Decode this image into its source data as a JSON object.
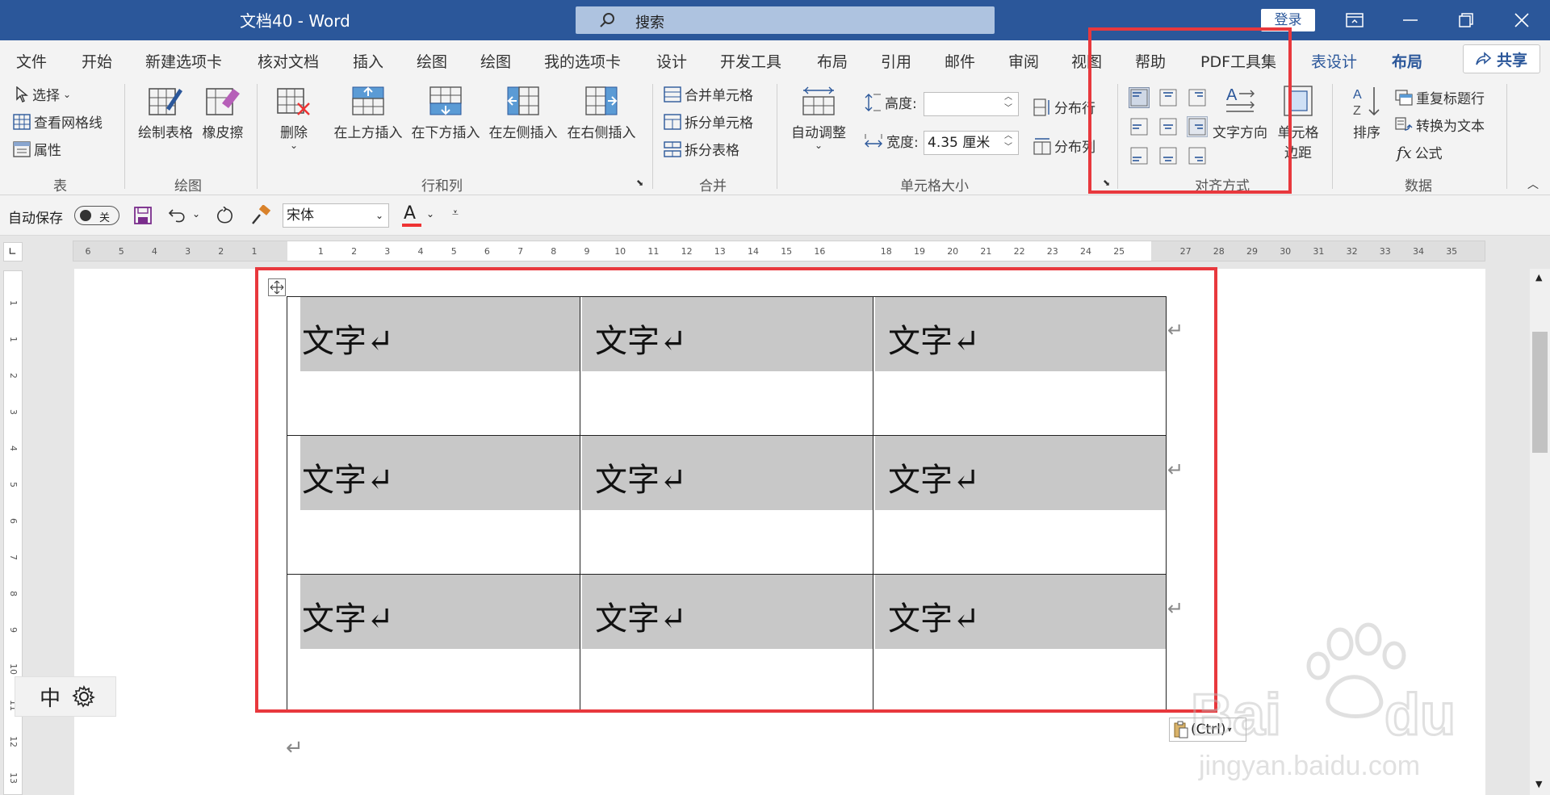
{
  "titlebar": {
    "doc_title": "文档40  -  Word",
    "search_label": "搜索",
    "login_label": "登录"
  },
  "tabs": {
    "items": [
      "文件",
      "开始",
      "新建选项卡",
      "核对文档",
      "插入",
      "绘图",
      "绘图",
      "我的选项卡",
      "设计",
      "开发工具",
      "布局",
      "引用",
      "邮件",
      "审阅",
      "视图",
      "帮助",
      "PDF工具集"
    ],
    "ctx_table_design": "表设计",
    "ctx_layout": "布局",
    "share_label": "共享"
  },
  "ribbon": {
    "table": {
      "select": "选择",
      "gridlines": "查看网格线",
      "properties": "属性",
      "group": "表"
    },
    "draw": {
      "draw_table": "绘制表格",
      "eraser": "橡皮擦",
      "group": "绘图"
    },
    "rows_cols": {
      "delete": "删除",
      "insert_above": "在上方插入",
      "insert_below": "在下方插入",
      "insert_left": "在左侧插入",
      "insert_right": "在右侧插入",
      "group": "行和列"
    },
    "merge": {
      "merge_cells": "合并单元格",
      "split_cells": "拆分单元格",
      "split_table": "拆分表格",
      "group": "合并"
    },
    "cell_size": {
      "autofit": "自动调整",
      "height_label": "高度:",
      "height_value": "",
      "width_label": "宽度:",
      "width_value": "4.35 厘米",
      "dist_rows": "分布行",
      "dist_cols": "分布列",
      "group": "单元格大小"
    },
    "alignment": {
      "text_direction": "文字方向",
      "cell_margins_1": "单元格",
      "cell_margins_2": "边距",
      "group": "对齐方式"
    },
    "data": {
      "sort": "排序",
      "repeat_header": "重复标题行",
      "convert_text": "转换为文本",
      "formula": "公式",
      "group": "数据"
    }
  },
  "qat": {
    "autosave_label": "自动保存",
    "autosave_state": "关",
    "font_name": "宋体"
  },
  "ruler": {
    "h_numbers": [
      "6",
      "5",
      "4",
      "3",
      "2",
      "1",
      "1",
      "2",
      "3",
      "4",
      "5",
      "6",
      "7",
      "8",
      "9",
      "10",
      "11",
      "12",
      "13",
      "14",
      "15",
      "16",
      "18",
      "19",
      "20",
      "21",
      "22",
      "23",
      "24",
      "25",
      "27",
      "28",
      "29",
      "30",
      "31",
      "32",
      "33",
      "34",
      "35"
    ],
    "v_numbers": [
      "1",
      "1",
      "2",
      "3",
      "4",
      "5",
      "6",
      "7",
      "8",
      "9",
      "10",
      "11",
      "12",
      "13"
    ]
  },
  "document": {
    "cells": [
      [
        "文字↵",
        "文字↵",
        "文字↵"
      ],
      [
        "文字↵",
        "文字↵",
        "文字↵"
      ],
      [
        "文字↵",
        "文字↵",
        "文字↵"
      ]
    ],
    "paragraph_mark": "↵",
    "paste_chip": "(Ctrl)"
  },
  "ime": {
    "mode": "中"
  },
  "colors": {
    "brand": "#2b579a",
    "highlight": "#e8383d",
    "cell_shading": "#c8c8c8"
  }
}
